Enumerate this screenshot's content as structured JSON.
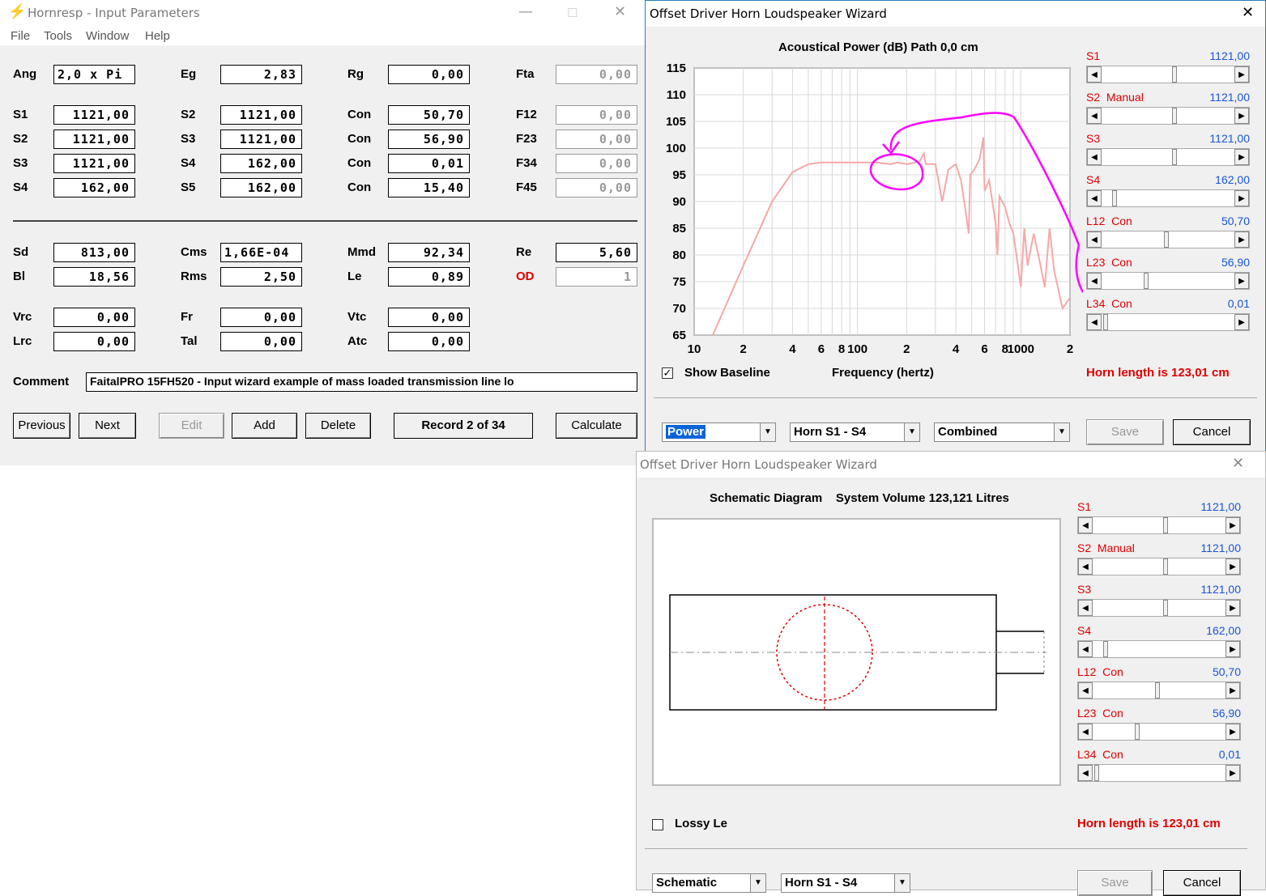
{
  "input_window": {
    "title": "Hornresp - Input Parameters",
    "title_buttons": {
      "minimize": "—",
      "maximize": "☐",
      "close": "✕"
    },
    "menu": [
      "File",
      "Tools",
      "Window",
      "Help"
    ],
    "rows": {
      "ang": {
        "label": "Ang",
        "value": "2,0 x Pi"
      },
      "eg": {
        "label": "Eg",
        "value": "2,83"
      },
      "rg": {
        "label": "Rg",
        "value": "0,00"
      },
      "fta": {
        "label": "Fta",
        "value": "0,00"
      },
      "s1": {
        "label": "S1",
        "value": "1121,00"
      },
      "s2": {
        "label": "S2",
        "value": "1121,00"
      },
      "con1": {
        "label": "Con",
        "value": "50,70"
      },
      "f12": {
        "label": "F12",
        "value": "0,00"
      },
      "s2b": {
        "label": "S2",
        "value": "1121,00"
      },
      "s3": {
        "label": "S3",
        "value": "1121,00"
      },
      "con2": {
        "label": "Con",
        "value": "56,90"
      },
      "f23": {
        "label": "F23",
        "value": "0,00"
      },
      "s3b": {
        "label": "S3",
        "value": "1121,00"
      },
      "s4": {
        "label": "S4",
        "value": "162,00"
      },
      "con3": {
        "label": "Con",
        "value": "0,01"
      },
      "f34": {
        "label": "F34",
        "value": "0,00"
      },
      "s4b": {
        "label": "S4",
        "value": "162,00"
      },
      "s5": {
        "label": "S5",
        "value": "162,00"
      },
      "con4": {
        "label": "Con",
        "value": "15,40"
      },
      "f45": {
        "label": "F45",
        "value": "0,00"
      },
      "sd": {
        "label": "Sd",
        "value": "813,00"
      },
      "cms": {
        "label": "Cms",
        "value": "1,66E-04"
      },
      "mmd": {
        "label": "Mmd",
        "value": "92,34"
      },
      "re": {
        "label": "Re",
        "value": "5,60"
      },
      "bl": {
        "label": "Bl",
        "value": "18,56"
      },
      "rms": {
        "label": "Rms",
        "value": "2,50"
      },
      "le": {
        "label": "Le",
        "value": "0,89"
      },
      "od": {
        "label": "OD",
        "value": "1"
      },
      "vrc": {
        "label": "Vrc",
        "value": "0,00"
      },
      "fr": {
        "label": "Fr",
        "value": "0,00"
      },
      "vtc": {
        "label": "Vtc",
        "value": "0,00"
      },
      "lrc": {
        "label": "Lrc",
        "value": "0,00"
      },
      "tal": {
        "label": "Tal",
        "value": "0,00"
      },
      "atc": {
        "label": "Atc",
        "value": "0,00"
      }
    },
    "comment_label": "Comment",
    "comment": "FaitalPRO 15FH520 - Input wizard example of mass loaded transmission line lo",
    "buttons": {
      "previous": "Previous",
      "next": "Next",
      "edit": "Edit",
      "add": "Add",
      "delete": "Delete",
      "record": "Record 2 of 34",
      "calculate": "Calculate"
    }
  },
  "wizard_top": {
    "title": "Offset Driver Horn Loudspeaker Wizard",
    "close": "✕",
    "chart_title": "Acoustical Power (dB)   Path 0,0 cm",
    "xlabel": "Frequency (hertz)",
    "show_baseline": "Show Baseline",
    "horn_length": "Horn length is 123,01 cm",
    "dropdowns": {
      "mode": "Power",
      "horn": "Horn S1 - S4",
      "combined": "Combined"
    },
    "buttons": {
      "save": "Save",
      "cancel": "Cancel"
    }
  },
  "wizard_bottom": {
    "title": "Offset Driver Horn Loudspeaker Wizard",
    "close": "✕",
    "heading": "Schematic Diagram    System Volume 123,121 Litres",
    "lossy": "Lossy Le",
    "horn_length": "Horn length is 123,01 cm",
    "dropdowns": {
      "mode": "Schematic",
      "horn": "Horn S1 - S4"
    },
    "buttons": {
      "save": "Save",
      "cancel": "Cancel"
    }
  },
  "sliders": [
    {
      "label": "S1",
      "value": "1121,00",
      "position": 0.55
    },
    {
      "label": "S2  Manual",
      "value": "1121,00",
      "position": 0.55
    },
    {
      "label": "S3",
      "value": "1121,00",
      "position": 0.55
    },
    {
      "label": "S4",
      "value": "162,00",
      "position": 0.08
    },
    {
      "label": "L12  Con",
      "value": "50,70",
      "position": 0.49
    },
    {
      "label": "L23  Con",
      "value": "56,90",
      "position": 0.33
    },
    {
      "label": "L34  Con",
      "value": "0,01",
      "position": 0.01
    }
  ],
  "chart_data": {
    "type": "line",
    "title": "Acoustical Power (dB)   Path 0,0 cm",
    "xlabel": "Frequency (hertz)",
    "ylabel": "",
    "x_scale": "log",
    "xlim": [
      10,
      2000
    ],
    "ylim": [
      65,
      115
    ],
    "x_ticks": [
      "10",
      "2",
      "4",
      "6",
      "8",
      "100",
      "2",
      "4",
      "6",
      "8",
      "1000",
      "2"
    ],
    "y_ticks": [
      115,
      110,
      105,
      100,
      95,
      90,
      85,
      80,
      75,
      70,
      65
    ],
    "grid": true,
    "color": "#f6a8a8",
    "points": [
      [
        13,
        65
      ],
      [
        20,
        78
      ],
      [
        30,
        90
      ],
      [
        40,
        95.5
      ],
      [
        50,
        97
      ],
      [
        60,
        97.3
      ],
      [
        80,
        97.3
      ],
      [
        100,
        97.3
      ],
      [
        130,
        97.3
      ],
      [
        160,
        97
      ],
      [
        175,
        97.3
      ],
      [
        200,
        97
      ],
      [
        240,
        97.5
      ],
      [
        255,
        99
      ],
      [
        262,
        97
      ],
      [
        300,
        97
      ],
      [
        330,
        90
      ],
      [
        360,
        96
      ],
      [
        400,
        97
      ],
      [
        430,
        94
      ],
      [
        460,
        88
      ],
      [
        480,
        84
      ],
      [
        490,
        95
      ],
      [
        520,
        96
      ],
      [
        560,
        98
      ],
      [
        590,
        102
      ],
      [
        600,
        92
      ],
      [
        640,
        94
      ],
      [
        700,
        86
      ],
      [
        720,
        80
      ],
      [
        740,
        91
      ],
      [
        800,
        89
      ],
      [
        850,
        86
      ],
      [
        900,
        84
      ],
      [
        950,
        79
      ],
      [
        1000,
        74
      ],
      [
        1050,
        85
      ],
      [
        1100,
        78
      ],
      [
        1200,
        84
      ],
      [
        1300,
        79
      ],
      [
        1400,
        74
      ],
      [
        1500,
        85
      ],
      [
        1600,
        77
      ],
      [
        1800,
        70
      ],
      [
        2000,
        72
      ]
    ]
  }
}
